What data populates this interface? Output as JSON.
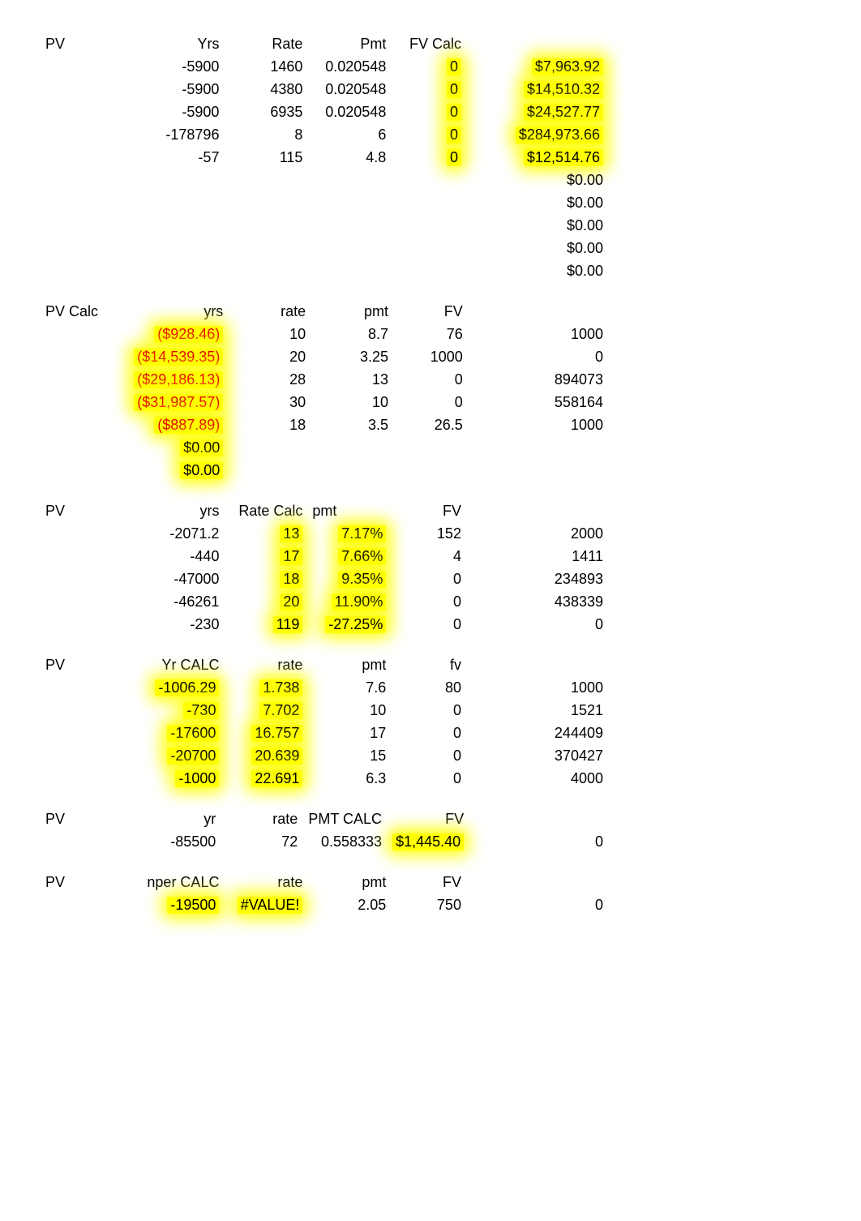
{
  "sections": [
    {
      "name": "fv-calc",
      "headers": [
        "PV",
        "Yrs",
        "Rate",
        "Pmt",
        "FV Calc",
        ""
      ],
      "header_hl": [
        false,
        false,
        false,
        false,
        false,
        false
      ],
      "rows": [
        {
          "c1": "",
          "c2": "-5900",
          "hl2": false,
          "c3": "1460",
          "hl3": false,
          "c4": "0.020548",
          "hl4": false,
          "c5": "0",
          "hl5": true,
          "c6": "$7,963.92",
          "hl6": true,
          "red6": false
        },
        {
          "c1": "",
          "c2": "-5900",
          "hl2": false,
          "c3": "4380",
          "hl3": false,
          "c4": "0.020548",
          "hl4": false,
          "c5": "0",
          "hl5": true,
          "c6": "$14,510.32",
          "hl6": true,
          "red6": false
        },
        {
          "c1": "",
          "c2": "-5900",
          "hl2": false,
          "c3": "6935",
          "hl3": false,
          "c4": "0.020548",
          "hl4": false,
          "c5": "0",
          "hl5": true,
          "c6": "$24,527.77",
          "hl6": true,
          "red6": false
        },
        {
          "c1": "",
          "c2": "-178796",
          "hl2": false,
          "c3": "8",
          "hl3": false,
          "c4": "6",
          "hl4": false,
          "c5": "0",
          "hl5": true,
          "c6": "$284,973.66",
          "hl6": true,
          "red6": false
        },
        {
          "c1": "",
          "c2": "-57",
          "hl2": false,
          "c3": "115",
          "hl3": false,
          "c4": "4.8",
          "hl4": false,
          "c5": "0",
          "hl5": true,
          "c6": "$12,514.76",
          "hl6": true,
          "red6": false
        },
        {
          "c1": "",
          "c2": "",
          "hl2": false,
          "c3": "",
          "hl3": false,
          "c4": "",
          "hl4": false,
          "c5": "",
          "hl5": false,
          "c6": "$0.00",
          "hl6": false,
          "red6": false
        },
        {
          "c1": "",
          "c2": "",
          "hl2": false,
          "c3": "",
          "hl3": false,
          "c4": "",
          "hl4": false,
          "c5": "",
          "hl5": false,
          "c6": "$0.00",
          "hl6": false,
          "red6": false
        },
        {
          "c1": "",
          "c2": "",
          "hl2": false,
          "c3": "",
          "hl3": false,
          "c4": "",
          "hl4": false,
          "c5": "",
          "hl5": false,
          "c6": "$0.00",
          "hl6": false,
          "red6": false
        },
        {
          "c1": "",
          "c2": "",
          "hl2": false,
          "c3": "",
          "hl3": false,
          "c4": "",
          "hl4": false,
          "c5": "",
          "hl5": false,
          "c6": "$0.00",
          "hl6": false,
          "red6": false
        },
        {
          "c1": "",
          "c2": "",
          "hl2": false,
          "c3": "",
          "hl3": false,
          "c4": "",
          "hl4": false,
          "c5": "",
          "hl5": false,
          "c6": "$0.00",
          "hl6": false,
          "red6": false
        }
      ]
    },
    {
      "name": "pv-calc",
      "headers": [
        "PV Calc",
        "yrs",
        "rate",
        "pmt",
        "FV",
        ""
      ],
      "header_hl": [
        false,
        false,
        false,
        false,
        false,
        false
      ],
      "rows": [
        {
          "c1": "",
          "c2": "($928.46)",
          "hl2": true,
          "red2": true,
          "c3": "10",
          "hl3": false,
          "c4": "8.7",
          "hl4": false,
          "c5": "76",
          "hl5": false,
          "c6": "1000",
          "hl6": false
        },
        {
          "c1": "",
          "c2": "($14,539.35)",
          "hl2": true,
          "red2": true,
          "c3": "20",
          "hl3": false,
          "c4": "3.25",
          "hl4": false,
          "c5": "1000",
          "hl5": false,
          "c6": "0",
          "hl6": false
        },
        {
          "c1": "",
          "c2": "($29,186.13)",
          "hl2": true,
          "red2": true,
          "c3": "28",
          "hl3": false,
          "c4": "13",
          "hl4": false,
          "c5": "0",
          "hl5": false,
          "c6": "894073",
          "hl6": false
        },
        {
          "c1": "",
          "c2": "($31,987.57)",
          "hl2": true,
          "red2": true,
          "c3": "30",
          "hl3": false,
          "c4": "10",
          "hl4": false,
          "c5": "0",
          "hl5": false,
          "c6": "558164",
          "hl6": false
        },
        {
          "c1": "",
          "c2": "($887.89)",
          "hl2": true,
          "red2": true,
          "c3": "18",
          "hl3": false,
          "c4": "3.5",
          "hl4": false,
          "c5": "26.5",
          "hl5": false,
          "c6": "1000",
          "hl6": false
        },
        {
          "c1": "",
          "c2": "$0.00",
          "hl2": true,
          "red2": false,
          "c3": "",
          "hl3": false,
          "c4": "",
          "hl4": false,
          "c5": "",
          "hl5": false,
          "c6": "",
          "hl6": false
        },
        {
          "c1": "",
          "c2": "$0.00",
          "hl2": true,
          "red2": false,
          "c3": "",
          "hl3": false,
          "c4": "",
          "hl4": false,
          "c5": "",
          "hl5": false,
          "c6": "",
          "hl6": false
        }
      ]
    },
    {
      "name": "rate-calc",
      "headers": [
        "PV",
        "yrs",
        "Rate Calc",
        "pmt",
        "FV",
        ""
      ],
      "header_align": [
        "left",
        "right",
        "right",
        "left",
        "right",
        "right"
      ],
      "header_hl": [
        false,
        false,
        false,
        false,
        false,
        false
      ],
      "rows": [
        {
          "c1": "",
          "c2": "-2071.2",
          "hl2": false,
          "c3": "13",
          "hl3": true,
          "c4": "7.17%",
          "hl4": true,
          "red4": false,
          "c5": "152",
          "hl5": false,
          "c6": "2000",
          "hl6": false
        },
        {
          "c1": "",
          "c2": "-440",
          "hl2": false,
          "c3": "17",
          "hl3": true,
          "c4": "7.66%",
          "hl4": true,
          "red4": false,
          "c5": "4",
          "hl5": false,
          "c6": "1411",
          "hl6": false
        },
        {
          "c1": "",
          "c2": "-47000",
          "hl2": false,
          "c3": "18",
          "hl3": true,
          "c4": "9.35%",
          "hl4": true,
          "red4": false,
          "c5": "0",
          "hl5": false,
          "c6": "234893",
          "hl6": false
        },
        {
          "c1": "",
          "c2": "-46261",
          "hl2": false,
          "c3": "20",
          "hl3": true,
          "c4": "11.90%",
          "hl4": true,
          "red4": false,
          "c5": "0",
          "hl5": false,
          "c6": "438339",
          "hl6": false
        },
        {
          "c1": "",
          "c2": "-230",
          "hl2": false,
          "c3": "119",
          "hl3": true,
          "c4": "-27.25%",
          "hl4": true,
          "red4": false,
          "c5": "0",
          "hl5": false,
          "c6": "0",
          "hl6": false
        }
      ]
    },
    {
      "name": "yr-calc",
      "headers": [
        "PV",
        "Yr CALC",
        "rate",
        "pmt",
        "fv",
        ""
      ],
      "header_hl": [
        false,
        false,
        false,
        false,
        false,
        false
      ],
      "rows": [
        {
          "c1": "",
          "c2": "-1006.29",
          "hl2": true,
          "c3": "1.738",
          "hl3": true,
          "c4": "7.6",
          "hl4": false,
          "c5": "80",
          "hl5": false,
          "c6": "1000",
          "hl6": false
        },
        {
          "c1": "",
          "c2": "-730",
          "hl2": true,
          "c3": "7.702",
          "hl3": true,
          "c4": "10",
          "hl4": false,
          "c5": "0",
          "hl5": false,
          "c6": "1521",
          "hl6": false
        },
        {
          "c1": "",
          "c2": "-17600",
          "hl2": true,
          "c3": "16.757",
          "hl3": true,
          "c4": "17",
          "hl4": false,
          "c5": "0",
          "hl5": false,
          "c6": "244409",
          "hl6": false
        },
        {
          "c1": "",
          "c2": "-20700",
          "hl2": true,
          "c3": "20.639",
          "hl3": true,
          "c4": "15",
          "hl4": false,
          "c5": "0",
          "hl5": false,
          "c6": "370427",
          "hl6": false
        },
        {
          "c1": "",
          "c2": "-1000",
          "hl2": true,
          "c3": "22.691",
          "hl3": true,
          "c4": "6.3",
          "hl4": false,
          "c5": "0",
          "hl5": false,
          "c6": "4000",
          "hl6": false
        }
      ]
    },
    {
      "name": "pmt-calc",
      "headers": [
        "PV",
        "yr",
        "rate",
        "PMT CALC",
        "FV",
        ""
      ],
      "header_hl": [
        false,
        false,
        false,
        false,
        false,
        false
      ],
      "rows": [
        {
          "c1": "",
          "c2": "-85500",
          "hl2": false,
          "c3": "72",
          "hl3": false,
          "c4": "0.558333",
          "hl4": false,
          "c5": "$1,445.40",
          "hl5": true,
          "c6": "0",
          "hl6": false
        }
      ]
    },
    {
      "name": "nper-calc",
      "headers": [
        "PV",
        "nper CALC",
        "rate",
        "pmt",
        "FV",
        ""
      ],
      "header_hl": [
        false,
        false,
        false,
        false,
        false,
        false
      ],
      "rows": [
        {
          "c1": "",
          "c2": "-19500",
          "hl2": true,
          "c3": "#VALUE!",
          "hl3": true,
          "c4": "2.05",
          "hl4": false,
          "c5": "750",
          "hl5": false,
          "c6": "0",
          "hl6": false
        }
      ]
    }
  ]
}
